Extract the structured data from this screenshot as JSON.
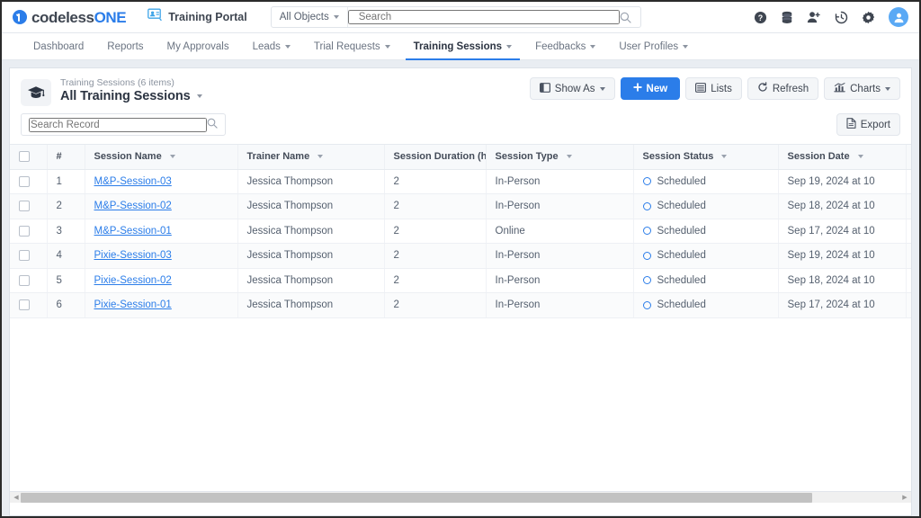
{
  "topbar": {
    "logo_main": "codeless",
    "logo_accent": "ONE",
    "portal_label": "Training Portal",
    "portal_icon": "presentation-user-icon",
    "search": {
      "objects_label": "All Objects",
      "placeholder": "Search",
      "value": "",
      "icon": "search-icon"
    },
    "icons": [
      {
        "name": "help-icon",
        "label": "Help"
      },
      {
        "name": "database-icon",
        "label": "Data"
      },
      {
        "name": "add-user-icon",
        "label": "Add User"
      },
      {
        "name": "history-icon",
        "label": "History"
      },
      {
        "name": "gear-icon",
        "label": "Settings"
      },
      {
        "name": "avatar",
        "label": "Account"
      }
    ]
  },
  "nav": {
    "tabs": [
      {
        "label": "Dashboard",
        "has_caret": false,
        "active": false
      },
      {
        "label": "Reports",
        "has_caret": false,
        "active": false
      },
      {
        "label": "My Approvals",
        "has_caret": false,
        "active": false
      },
      {
        "label": "Leads",
        "has_caret": true,
        "active": false
      },
      {
        "label": "Trial Requests",
        "has_caret": true,
        "active": false
      },
      {
        "label": "Training Sessions",
        "has_caret": true,
        "active": true
      },
      {
        "label": "Feedbacks",
        "has_caret": true,
        "active": false
      },
      {
        "label": "User Profiles",
        "has_caret": true,
        "active": false
      }
    ]
  },
  "list_header": {
    "object_icon": "graduation-cap-icon",
    "subtitle": "Training Sessions (6 items)",
    "title": "All Training Sessions",
    "toolbar": [
      {
        "label": "Show As",
        "icon": "layout-icon",
        "caret": true,
        "primary": false
      },
      {
        "label": "New",
        "icon": "plus-icon",
        "caret": false,
        "primary": true
      },
      {
        "label": "Lists",
        "icon": "list-icon",
        "caret": false,
        "primary": false
      },
      {
        "label": "Refresh",
        "icon": "refresh-icon",
        "caret": false,
        "primary": false
      },
      {
        "label": "Charts",
        "icon": "chart-icon",
        "caret": true,
        "primary": false
      }
    ]
  },
  "search_record": {
    "placeholder": "Search Record",
    "value": "",
    "icon": "search-icon"
  },
  "export_button": {
    "label": "Export",
    "icon": "document-icon"
  },
  "table": {
    "columns": [
      {
        "key": "select",
        "label": "",
        "sortable": false
      },
      {
        "key": "num",
        "label": "#",
        "sortable": false
      },
      {
        "key": "name",
        "label": "Session Name",
        "sortable": true
      },
      {
        "key": "trainer",
        "label": "Trainer Name",
        "sortable": true
      },
      {
        "key": "duration",
        "label": "Session Duration (h",
        "sortable": false
      },
      {
        "key": "type",
        "label": "Session Type",
        "sortable": true
      },
      {
        "key": "status",
        "label": "Session Status",
        "sortable": true
      },
      {
        "key": "date",
        "label": "Session Date",
        "sortable": true
      },
      {
        "key": "actions",
        "label": "",
        "sortable": false
      }
    ],
    "rows": [
      {
        "num": "1",
        "name": "M&P-Session-03",
        "trainer": "Jessica Thompson",
        "duration": "2",
        "type": "In-Person",
        "status": "Scheduled",
        "date": "Sep 19, 2024 at 10"
      },
      {
        "num": "2",
        "name": "M&P-Session-02",
        "trainer": "Jessica Thompson",
        "duration": "2",
        "type": "In-Person",
        "status": "Scheduled",
        "date": "Sep 18, 2024 at 10"
      },
      {
        "num": "3",
        "name": "M&P-Session-01",
        "trainer": "Jessica Thompson",
        "duration": "2",
        "type": "Online",
        "status": "Scheduled",
        "date": "Sep 17, 2024 at 10"
      },
      {
        "num": "4",
        "name": "Pixie-Session-03",
        "trainer": "Jessica Thompson",
        "duration": "2",
        "type": "In-Person",
        "status": "Scheduled",
        "date": "Sep 19, 2024 at 10"
      },
      {
        "num": "5",
        "name": "Pixie-Session-02",
        "trainer": "Jessica Thompson",
        "duration": "2",
        "type": "In-Person",
        "status": "Scheduled",
        "date": "Sep 18, 2024 at 10"
      },
      {
        "num": "6",
        "name": "Pixie-Session-01",
        "trainer": "Jessica Thompson",
        "duration": "2",
        "type": "In-Person",
        "status": "Scheduled",
        "date": "Sep 17, 2024 at 10"
      }
    ],
    "row_action_icon": "ellipsis-icon"
  },
  "scrollbar": {
    "left_arrow": "◀",
    "right_arrow": "▶",
    "thumb_percent": 90
  },
  "colors": {
    "accent": "#2b7de9",
    "link": "#2b7de9",
    "page_bg": "#e9edf2",
    "header_bg": "#f7f9fb",
    "status_ring": "#2b7de9"
  }
}
